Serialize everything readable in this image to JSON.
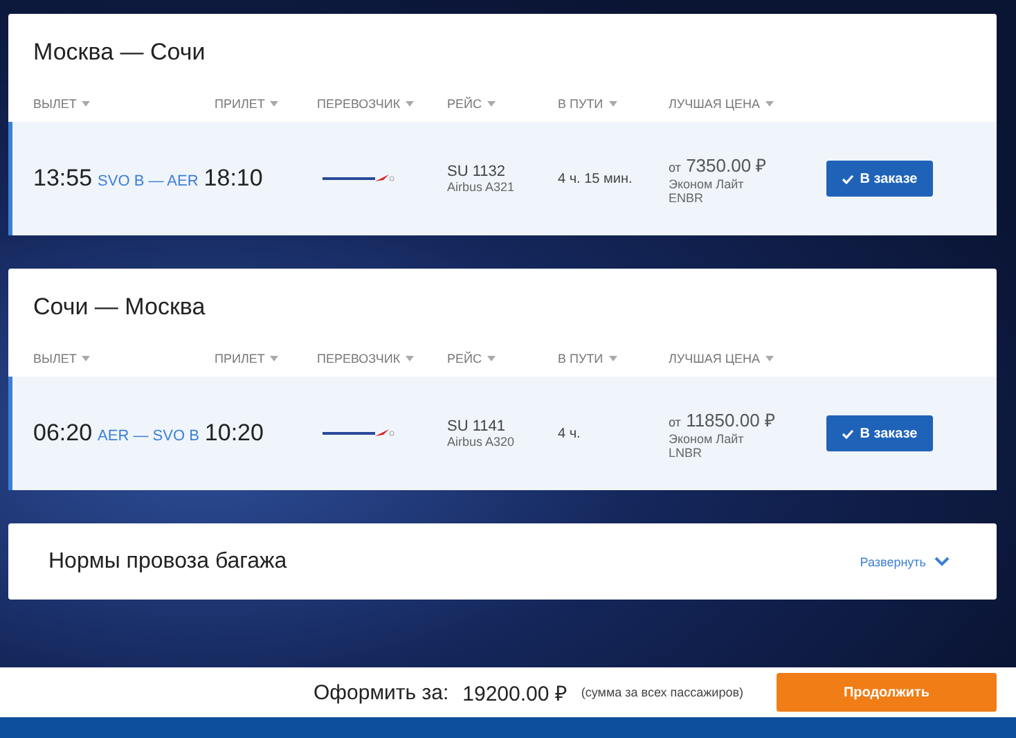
{
  "segments": [
    {
      "title": "Москва — Сочи",
      "columns": [
        "ВЫЛЕТ",
        "ПРИЛЕТ",
        "ПЕРЕВОЗЧИК",
        "РЕЙС",
        "В ПУТИ",
        "ЛУЧШАЯ ЦЕНА"
      ],
      "flight": {
        "selected": true,
        "depart": "13:55",
        "route": "SVO B — AER",
        "arrive": "18:10",
        "number": "SU 1132",
        "aircraft": "Airbus A321",
        "duration": "4 ч. 15 мин.",
        "price_prefix": "от",
        "price": "7350.00 ₽",
        "fare": "Эконом Лайт",
        "fare_code": "ENBR",
        "button": "В заказе"
      }
    },
    {
      "title": "Сочи — Москва",
      "columns": [
        "ВЫЛЕТ",
        "ПРИЛЕТ",
        "ПЕРЕВОЗЧИК",
        "РЕЙС",
        "В ПУТИ",
        "ЛУЧШАЯ ЦЕНА"
      ],
      "flight": {
        "selected": true,
        "depart": "06:20",
        "route": "AER — SVO B",
        "arrive": "10:20",
        "number": "SU 1141",
        "aircraft": "Airbus A320",
        "duration": "4 ч.",
        "price_prefix": "от",
        "price": "11850.00 ₽",
        "fare": "Эконом Лайт",
        "fare_code": "LNBR",
        "button": "В заказе"
      }
    }
  ],
  "baggage": {
    "title": "Нормы провоза багажа",
    "toggle": "Развернуть",
    "expanded": false
  },
  "footer": {
    "label": "Оформить за:",
    "total": "19200.00 ₽",
    "note": "(сумма за всех пассажиров)",
    "button": "Продолжить"
  }
}
